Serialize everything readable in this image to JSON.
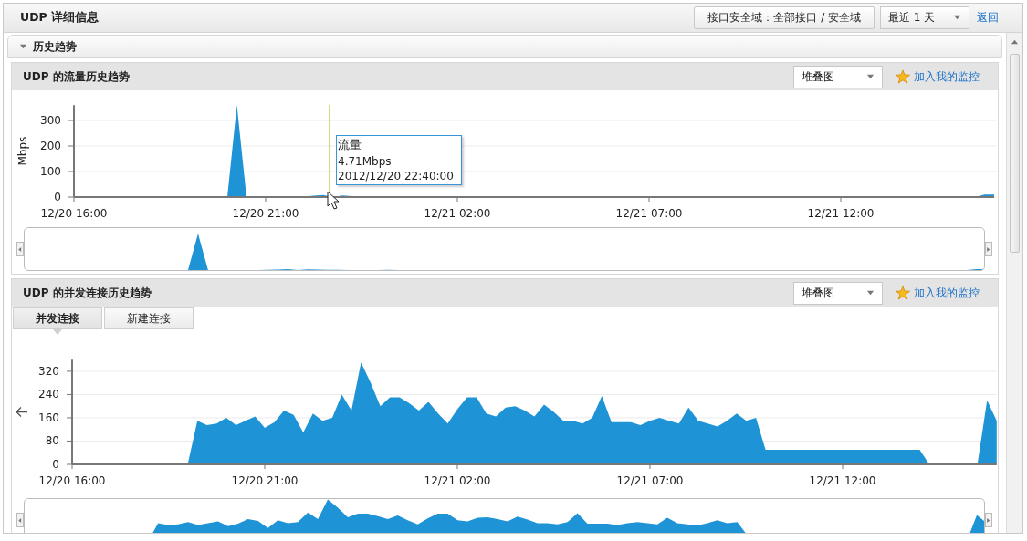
{
  "title": "UDP 详细信息",
  "toolbar": {
    "zone_button": "接口安全域：全部接口 / 安全域",
    "range_select": "最近 1 天",
    "back_link": "返回"
  },
  "section": {
    "title": "历史趋势",
    "expanded": true
  },
  "panels": [
    {
      "title": "UDP 的流量历史趋势",
      "view_select": "堆叠图",
      "monitor_link": "加入我的监控",
      "tooltip": {
        "title": "流量",
        "lines": [
          "4.71Mbps",
          "2012/12/20 22:40:00"
        ]
      },
      "chart_data": {
        "type": "area",
        "ylabel": "Mbps",
        "ylim": [
          0,
          360
        ],
        "grid": true,
        "categories": [
          "12/20 16:00",
          null,
          null,
          null,
          null,
          null,
          null,
          null,
          null,
          null,
          null,
          null,
          null,
          null,
          null,
          null,
          null,
          null,
          null,
          null,
          "12/20 21:00",
          null,
          null,
          null,
          null,
          null,
          null,
          null,
          null,
          null,
          null,
          null,
          null,
          null,
          null,
          null,
          null,
          null,
          null,
          null,
          "12/21 02:00",
          null,
          null,
          null,
          null,
          null,
          null,
          null,
          null,
          null,
          null,
          null,
          null,
          null,
          null,
          null,
          null,
          null,
          null,
          null,
          "12/21 07:00",
          null,
          null,
          null,
          null,
          null,
          null,
          null,
          null,
          null,
          null,
          null,
          null,
          null,
          null,
          null,
          null,
          null,
          null,
          null,
          "12/21 12:00",
          null,
          null,
          null,
          null,
          null,
          null,
          null,
          null,
          null,
          null,
          null,
          null,
          null,
          null,
          null,
          null
        ],
        "yticks": [
          0,
          100,
          200,
          300
        ],
        "series": [
          {
            "color": "#1e93d6",
            "values": [
              0,
              0,
              0,
              0,
              0,
              0,
              0,
              0,
              0,
              0,
              0,
              0,
              0,
              0,
              0,
              0,
              0,
              360,
              0,
              0,
              0,
              0,
              0,
              0,
              2,
              5,
              8,
              null,
              6,
              4,
              3,
              2,
              0,
              0,
              0,
              0,
              3,
              0,
              0,
              0,
              0,
              0,
              0,
              0,
              0,
              0,
              0,
              0,
              0,
              0,
              0,
              0,
              0,
              0,
              0,
              0,
              0,
              0,
              0,
              0,
              0,
              0,
              0,
              0,
              0,
              0,
              0,
              0,
              0,
              0,
              0,
              0,
              0,
              0,
              0,
              0,
              0,
              0,
              0,
              0,
              0,
              0,
              0,
              0,
              0,
              0,
              0,
              0,
              0,
              0,
              0,
              0,
              0,
              0,
              0,
              10,
              10
            ]
          }
        ]
      }
    },
    {
      "title": "UDP 的并发连接历史趋势",
      "view_select": "堆叠图",
      "monitor_link": "加入我的监控",
      "tabs": [
        {
          "label": "并发连接",
          "selected": true
        },
        {
          "label": "新建连接",
          "selected": false
        }
      ],
      "chart_data": {
        "type": "area",
        "ylim": [
          0,
          360
        ],
        "grid": true,
        "categories": [
          "12/20 16:00",
          null,
          null,
          null,
          null,
          null,
          null,
          null,
          null,
          null,
          null,
          null,
          null,
          null,
          null,
          null,
          null,
          null,
          null,
          null,
          "12/20 21:00",
          null,
          null,
          null,
          null,
          null,
          null,
          null,
          null,
          null,
          null,
          null,
          null,
          null,
          null,
          null,
          null,
          null,
          null,
          null,
          "12/21 02:00",
          null,
          null,
          null,
          null,
          null,
          null,
          null,
          null,
          null,
          null,
          null,
          null,
          null,
          null,
          null,
          null,
          null,
          null,
          null,
          "12/21 07:00",
          null,
          null,
          null,
          null,
          null,
          null,
          null,
          null,
          null,
          null,
          null,
          null,
          null,
          null,
          null,
          null,
          null,
          null,
          null,
          "12/21 12:00",
          null,
          null,
          null,
          null,
          null,
          null,
          null,
          null,
          null,
          null,
          null,
          null,
          null,
          null,
          null,
          null
        ],
        "yticks": [
          0,
          80,
          160,
          240,
          320
        ],
        "series": [
          {
            "color": "#1e93d6",
            "values": [
              0,
              0,
              0,
              0,
              0,
              0,
              0,
              0,
              0,
              0,
              0,
              0,
              0,
              150,
              135,
              140,
              160,
              135,
              150,
              165,
              125,
              145,
              185,
              170,
              110,
              175,
              150,
              160,
              240,
              185,
              350,
              280,
              200,
              230,
              230,
              210,
              185,
              215,
              175,
              140,
              190,
              230,
              230,
              175,
              165,
              195,
              200,
              185,
              165,
              205,
              180,
              150,
              150,
              140,
              160,
              235,
              145,
              145,
              145,
              135,
              150,
              160,
              150,
              140,
              195,
              150,
              140,
              130,
              150,
              175,
              150,
              160,
              50,
              50,
              50,
              50,
              50,
              50,
              50,
              50,
              50,
              50,
              50,
              50,
              50,
              50,
              50,
              50,
              50,
              0,
              0,
              0,
              0,
              0,
              0,
              220,
              150
            ]
          }
        ]
      }
    }
  ]
}
